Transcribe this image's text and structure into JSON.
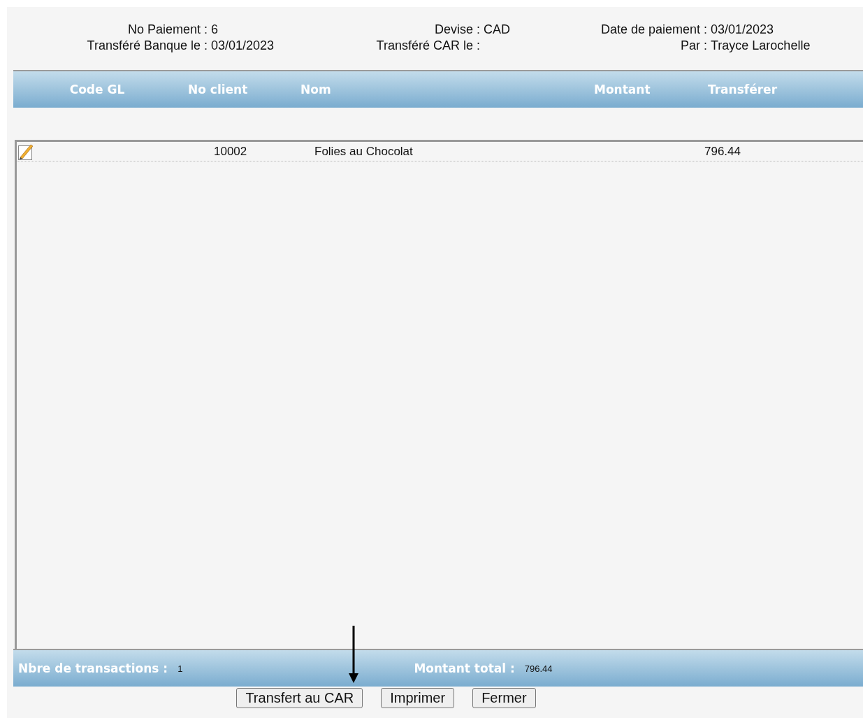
{
  "info": [
    {
      "label": "No Paiement :",
      "value": "6"
    },
    {
      "label": "Devise :",
      "value": "CAD"
    },
    {
      "label": "Date de paiement :",
      "value": "03/01/2023"
    },
    {
      "label": "Transféré Banque le :",
      "value": "03/01/2023"
    },
    {
      "label": "Transféré CAR le :"
    },
    {
      "label": "Par :",
      "value": "Trayce Larochelle"
    }
  ],
  "table": {
    "columns": [
      "Code GL",
      "No client",
      "Nom",
      "Montant",
      "Transférer"
    ],
    "rows": [
      {
        "editable": true,
        "client": "10002",
        "name": "Folies au Chocolat",
        "amount": "796.44"
      }
    ]
  },
  "footer": {
    "count_label": "Nbre de transactions :",
    "count": "1",
    "total_label": "Montant total :",
    "total": "796.44"
  },
  "buttons": [
    "Transfert au CAR",
    "Imprimer",
    "Fermer"
  ]
}
